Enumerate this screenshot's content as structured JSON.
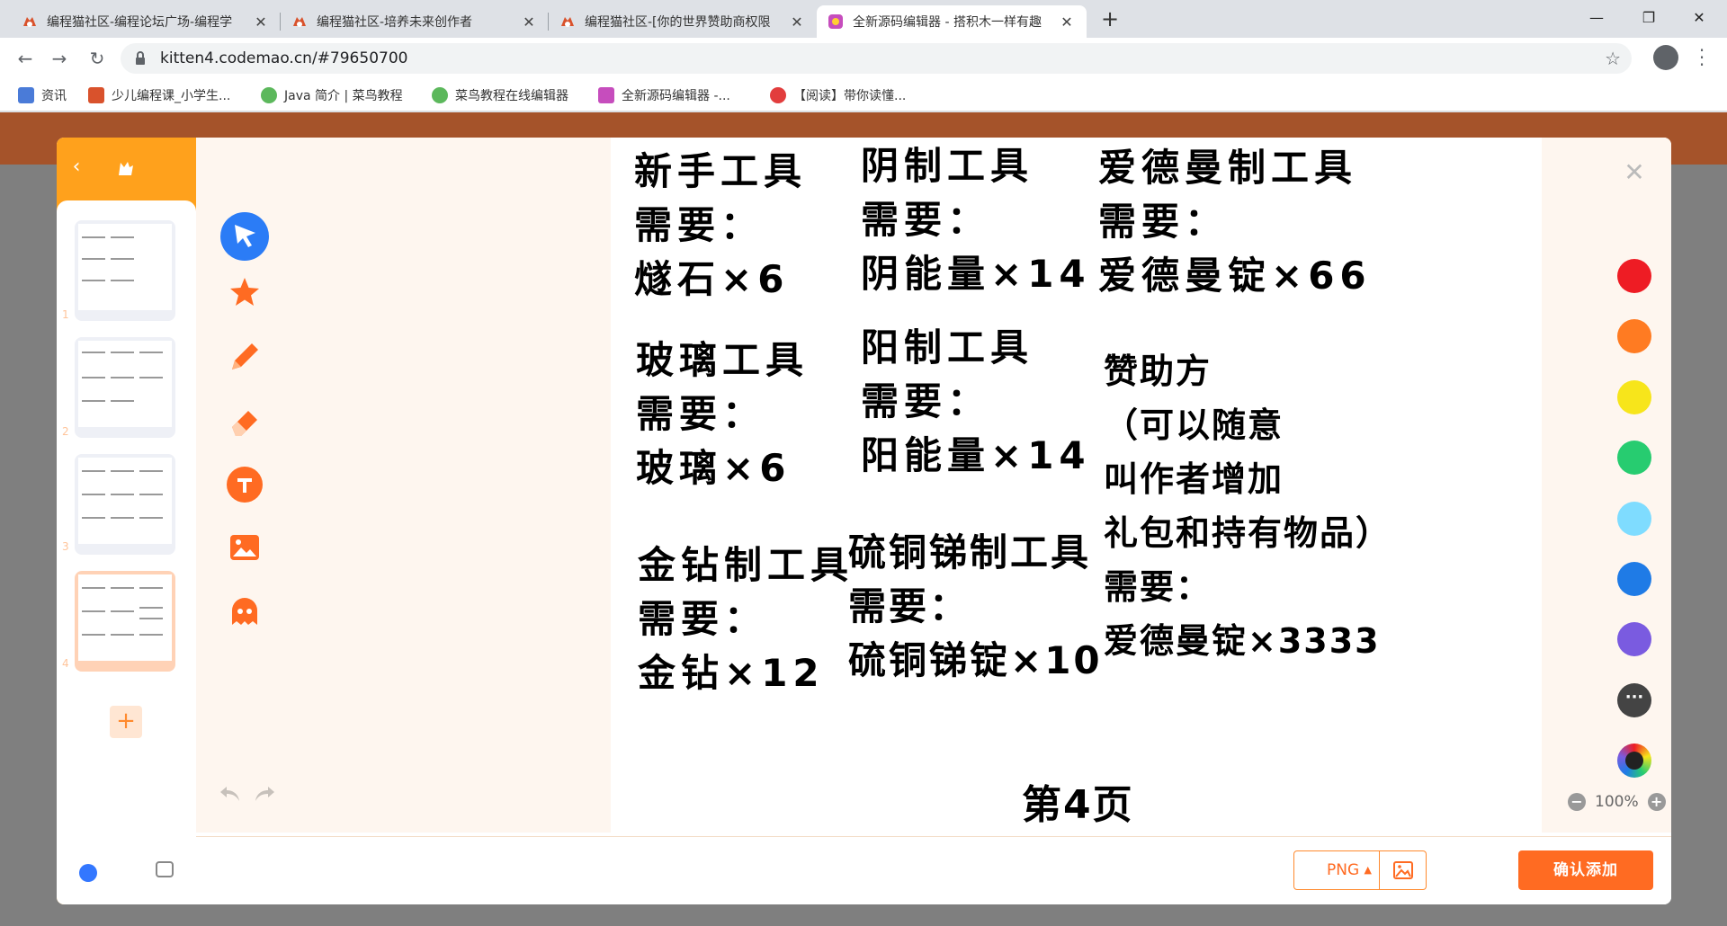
{
  "browser": {
    "tabs": [
      {
        "label": "编程猫社区-编程论坛广场-编程学",
        "active": false
      },
      {
        "label": "编程猫社区-培养未来创作者",
        "active": false
      },
      {
        "label": "编程猫社区-[你的世界赞助商权限",
        "active": false
      },
      {
        "label": "全新源码编辑器 - 搭积木一样有趣",
        "active": true
      }
    ],
    "tab_close": "✕",
    "new_tab": "+",
    "window_controls": [
      "—",
      "❐",
      "✕"
    ],
    "url": "kitten4.codemao.cn/#79650700",
    "bookmarks": [
      {
        "label": "资讯",
        "color": "#4a7bd8"
      },
      {
        "label": "少儿编程课_小学生...",
        "color": "#d9522c"
      },
      {
        "label": "Java 简介 | 菜鸟教程",
        "color": "#5cb85c"
      },
      {
        "label": "菜鸟教程在线编辑器",
        "color": "#5cb85c"
      },
      {
        "label": "全新源码编辑器 -...",
        "color": "#c64dbd"
      },
      {
        "label": "【阅读】带你读懂...",
        "color": "#e23d3d"
      }
    ]
  },
  "editor": {
    "back": "‹",
    "add_page": "+",
    "page_numbers": [
      "1",
      "2",
      "3",
      "4"
    ],
    "tools": [
      "select",
      "star",
      "pen",
      "eraser",
      "text",
      "image",
      "ghost"
    ],
    "colors": [
      "#ee1c24",
      "#ff7b22",
      "#f7e51b",
      "#27cc70",
      "#7fdcff",
      "#1f7be6",
      "#7a5be0"
    ],
    "more_colors": "···",
    "zoom": "100%",
    "zoom_out": "−",
    "zoom_in": "+",
    "format": "PNG",
    "confirm": "确认添加",
    "close": "✕"
  },
  "canvas": {
    "blocks": [
      {
        "lines": [
          "新手工具",
          "需要：",
          "燧石×6"
        ]
      },
      {
        "lines": [
          "阴制工具",
          "需要：",
          "阴能量×14"
        ]
      },
      {
        "lines": [
          "爱德曼制工具",
          "需要：",
          "爱德曼锭×66"
        ]
      },
      {
        "lines": [
          "玻璃工具",
          "需要：",
          "玻璃×6"
        ]
      },
      {
        "lines": [
          "阳制工具",
          "需要：",
          "阳能量×14"
        ]
      },
      {
        "lines": [
          "赞助方",
          "（可以随意",
          "叫作者增加",
          "礼包和持有物品）",
          "需要：",
          "爱德曼锭×3333"
        ]
      },
      {
        "lines": [
          "金钻制工具",
          "需要：",
          "金钻×12"
        ]
      },
      {
        "lines": [
          "硫铜锑制工具",
          "需要：",
          "硫铜锑锭×10"
        ]
      }
    ],
    "page_label": "第4页"
  }
}
